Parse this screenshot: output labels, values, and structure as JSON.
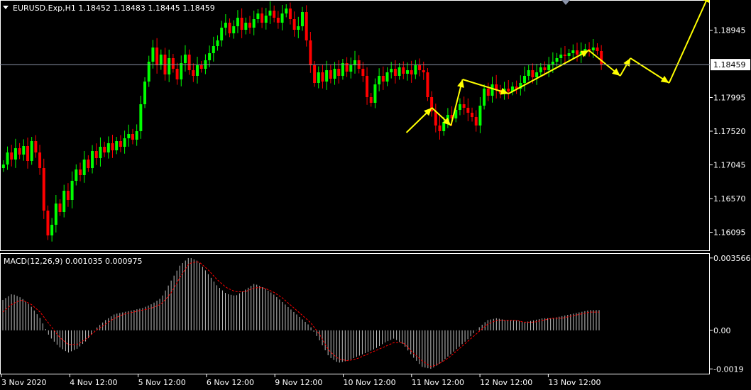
{
  "header": {
    "symbol_line": "EURUSD.Exp,H1  1.18452 1.18483 1.18445 1.18459"
  },
  "indicator": {
    "title": "MACD(12,26,9) 0.001035 0.000975"
  },
  "colors": {
    "background": "#000000",
    "frame": "#ffffff",
    "bull": "#00ff00",
    "bear": "#ff0000",
    "arrow": "#ffff00",
    "price_line": "#8a93a8",
    "macd_hist": "#c0c0c0",
    "signal": "#ff0000"
  },
  "chart_data": [
    {
      "type": "candlestick",
      "title": "EURUSD.Exp,H1",
      "ylim": [
        1.1585,
        1.1935
      ],
      "price_ticks": [
        "1.18945",
        "1.18459",
        "1.17995",
        "1.17520",
        "1.17045",
        "1.16570",
        "1.16095"
      ],
      "current_price": "1.18459",
      "x_ticks": [
        "3 Nov 2020",
        "4 Nov 12:00",
        "5 Nov 12:00",
        "6 Nov 12:00",
        "9 Nov 12:00",
        "10 Nov 12:00",
        "11 Nov 12:00",
        "12 Nov 12:00",
        "13 Nov 12:00"
      ],
      "closes": [
        1.1705,
        1.1722,
        1.1712,
        1.1728,
        1.1719,
        1.1731,
        1.171,
        1.1738,
        1.1722,
        1.17,
        1.164,
        1.1605,
        1.162,
        1.165,
        1.1638,
        1.1668,
        1.1655,
        1.1682,
        1.1698,
        1.169,
        1.1712,
        1.17,
        1.1724,
        1.1714,
        1.173,
        1.1722,
        1.1735,
        1.1725,
        1.1738,
        1.173,
        1.1742,
        1.1748,
        1.174,
        1.1752,
        1.179,
        1.1822,
        1.185,
        1.187,
        1.1845,
        1.186,
        1.1832,
        1.1855,
        1.184,
        1.1825,
        1.1848,
        1.186,
        1.1838,
        1.183,
        1.1845,
        1.184,
        1.1852,
        1.1862,
        1.1872,
        1.188,
        1.1898,
        1.1905,
        1.189,
        1.19,
        1.1912,
        1.1895,
        1.1905,
        1.1898,
        1.191,
        1.1918,
        1.1905,
        1.1915,
        1.1922,
        1.1912,
        1.1905,
        1.1918,
        1.1925,
        1.191,
        1.1895,
        1.19,
        1.192,
        1.188,
        1.1845,
        1.182,
        1.1835,
        1.1822,
        1.1838,
        1.1826,
        1.184,
        1.183,
        1.1848,
        1.1836,
        1.1845,
        1.1852,
        1.184,
        1.183,
        1.18,
        1.1792,
        1.1818,
        1.183,
        1.1822,
        1.1835,
        1.184,
        1.183,
        1.1842,
        1.1833,
        1.1838,
        1.1832,
        1.1845,
        1.1838,
        1.1835,
        1.18,
        1.178,
        1.176,
        1.1752,
        1.1765,
        1.1775,
        1.177,
        1.1782,
        1.179,
        1.1785,
        1.1778,
        1.1772,
        1.176,
        1.1788,
        1.1812,
        1.1802,
        1.1818,
        1.181,
        1.1805,
        1.1812,
        1.1808,
        1.1815,
        1.1812,
        1.182,
        1.183,
        1.1838,
        1.1828,
        1.1835,
        1.1842,
        1.1838,
        1.1846,
        1.185,
        1.1855,
        1.186,
        1.1858,
        1.1862,
        1.1866,
        1.186,
        1.1864,
        1.1868,
        1.1866,
        1.187,
        1.1865,
        1.18459
      ],
      "arrows": [
        [
          [
            1.175,
            0.555
          ],
          [
            1.1785,
            0.59
          ]
        ],
        [
          [
            1.1785,
            0.59
          ],
          [
            1.176,
            0.616
          ]
        ],
        [
          [
            1.176,
            0.616
          ],
          [
            1.1825,
            0.632
          ]
        ],
        [
          [
            1.1825,
            0.632
          ],
          [
            1.1805,
            0.695
          ]
        ],
        [
          [
            1.1805,
            0.695
          ],
          [
            1.1866,
            0.805
          ]
        ],
        [
          [
            1.1866,
            0.805
          ],
          [
            1.183,
            0.848
          ]
        ],
        [
          [
            1.183,
            0.848
          ],
          [
            1.1855,
            0.862
          ]
        ],
        [
          [
            1.1855,
            0.862
          ],
          [
            1.182,
            0.915
          ]
        ],
        [
          [
            1.182,
            0.915
          ],
          [
            1.1945,
            0.97
          ]
        ]
      ]
    },
    {
      "type": "bar+line",
      "title": "MACD(12,26,9)",
      "ylim": [
        -0.0021,
        0.0037
      ],
      "y_ticks": [
        "0.003566",
        "0.00",
        "-0.0019"
      ],
      "histogram": [
        0.0015,
        0.0018,
        0.0016,
        0.0012,
        0.0006,
        -0.0003,
        -0.0008,
        -0.0011,
        -0.0009,
        -0.0005,
        0.0001,
        0.0005,
        0.0008,
        0.0009,
        0.001,
        0.0011,
        0.0013,
        0.0016,
        0.0024,
        0.0032,
        0.0036,
        0.0034,
        0.0028,
        0.0022,
        0.0018,
        0.0017,
        0.002,
        0.0023,
        0.0021,
        0.0018,
        0.0014,
        0.001,
        0.0006,
        0.0002,
        -0.0005,
        -0.0013,
        -0.0016,
        -0.0015,
        -0.0013,
        -0.0011,
        -0.0009,
        -0.0006,
        -0.0004,
        -0.0007,
        -0.0013,
        -0.0018,
        -0.0019,
        -0.0016,
        -0.0012,
        -0.0008,
        -0.0004,
        0.0001,
        0.0005,
        0.0006,
        0.0005,
        0.0005,
        0.0004,
        0.0005,
        0.0006,
        0.0006,
        0.0007,
        0.0008,
        0.0009,
        0.001,
        0.001
      ],
      "signal": [
        0.0009,
        0.0013,
        0.0015,
        0.0013,
        0.0009,
        0.0003,
        -0.0003,
        -0.0007,
        -0.0007,
        -0.0004,
        0.0,
        0.0003,
        0.0006,
        0.0008,
        0.0009,
        0.001,
        0.0011,
        0.0013,
        0.0018,
        0.0026,
        0.0033,
        0.0034,
        0.003,
        0.0025,
        0.0021,
        0.0019,
        0.0019,
        0.0021,
        0.0021,
        0.0019,
        0.0016,
        0.0012,
        0.0008,
        0.0004,
        -0.0002,
        -0.001,
        -0.0014,
        -0.0015,
        -0.0014,
        -0.0012,
        -0.001,
        -0.0008,
        -0.0006,
        -0.0006,
        -0.0011,
        -0.0015,
        -0.0018,
        -0.0016,
        -0.0013,
        -0.0009,
        -0.0005,
        -0.0001,
        0.0003,
        0.0005,
        0.0005,
        0.0005,
        0.0004,
        0.0004,
        0.0005,
        0.0006,
        0.0006,
        0.0007,
        0.0008,
        0.0009,
        0.0009
      ]
    }
  ]
}
